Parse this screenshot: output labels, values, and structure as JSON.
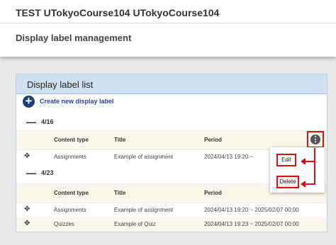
{
  "course": {
    "title": "TEST UTokyoCourse104 UTokyoCourse104"
  },
  "page": {
    "title": "Display label management"
  },
  "panel": {
    "title": "Display label list",
    "create_label": "Create new display label"
  },
  "columns": {
    "content_type": "Content type",
    "title": "Title",
    "period": "Period"
  },
  "groups": [
    {
      "date": "4/16",
      "rows": [
        {
          "content_type": "Assignments",
          "title": "Example of assignment",
          "period": "2024/04/13 19:20  ~"
        }
      ]
    },
    {
      "date": "4/23",
      "rows": [
        {
          "content_type": "Assignments",
          "title": "Example of assignment",
          "period": "2024/04/13 19:20  ~  2025/02/07 00:00"
        },
        {
          "content_type": "Quizzes",
          "title": "Example of Quiz",
          "period": "2024/04/13 19:23  ~  2025/02/07 00:00"
        }
      ]
    }
  ],
  "menu": {
    "edit": "Edit",
    "delete": "Delete"
  },
  "icons": {
    "create": "plus-circle-icon",
    "collapse": "minus-icon",
    "drag": "move-icon",
    "more": "more-vertical-icon"
  },
  "colors": {
    "panel_header": "#cfe0f1",
    "link": "#2a41a8",
    "highlight": "#dd1111",
    "row_alt": "#fbf6ea"
  }
}
